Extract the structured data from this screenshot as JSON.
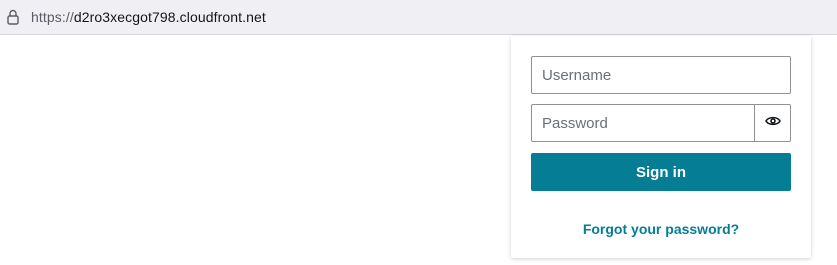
{
  "browser": {
    "url_scheme": "https://",
    "url_host": "d2ro3xecgot798.cloudfront.net",
    "lock_icon": "lock-icon"
  },
  "login": {
    "username_placeholder": "Username",
    "username_value": "",
    "password_placeholder": "Password",
    "password_value": "",
    "show_password_icon": "eye-icon",
    "sign_in_label": "Sign in",
    "forgot_password_label": "Forgot your password?"
  },
  "colors": {
    "accent": "#047d95",
    "urlbar_bg": "#f0f0f4",
    "field_border": "#8d9096"
  }
}
